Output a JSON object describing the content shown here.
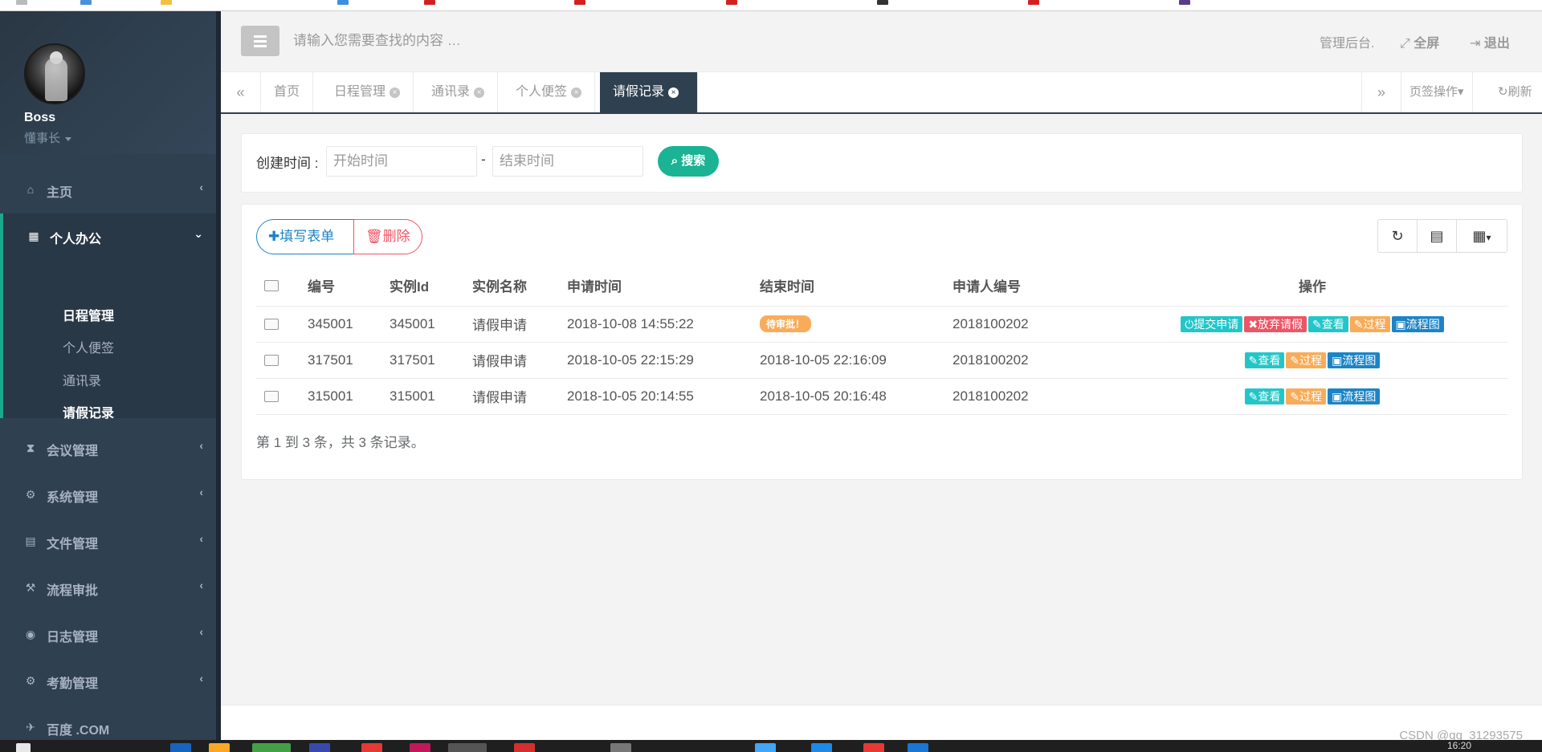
{
  "sidebar": {
    "user_name": "Boss",
    "user_role": "懂事长",
    "nav": [
      {
        "label": "主页",
        "icon": "home-icon"
      },
      {
        "label": "个人办公",
        "icon": "calendar-icon"
      },
      {
        "label": "会议管理",
        "icon": "hourglass-icon"
      },
      {
        "label": "系统管理",
        "icon": "gear-icon"
      },
      {
        "label": "文件管理",
        "icon": "file-icon"
      },
      {
        "label": "流程审批",
        "icon": "gavel-icon"
      },
      {
        "label": "日志管理",
        "icon": "eye-icon"
      },
      {
        "label": "考勤管理",
        "icon": "gears-icon"
      },
      {
        "label": "百度 .COM",
        "icon": "plane-icon"
      }
    ],
    "submenu": [
      "日程管理",
      "个人便签",
      "通讯录",
      "请假记录"
    ]
  },
  "topbar": {
    "search_placeholder": "请输入您需要查找的内容 …",
    "admin_label": "管理后台.",
    "fullscreen_label": "全屏",
    "logout_label": "退出"
  },
  "tabs": {
    "items": [
      "首页",
      "日程管理",
      "通讯录",
      "个人便签",
      "请假记录"
    ],
    "page_ops": "页签操作",
    "refresh": "刷新"
  },
  "filter": {
    "label": "创建时间 :",
    "start_placeholder": "开始时间",
    "separator": "-",
    "end_placeholder": "结束时间",
    "search_button": "搜索"
  },
  "toolbar": {
    "add_label": "填写表单",
    "delete_label": "删除"
  },
  "table": {
    "headers": [
      "编号",
      "实例Id",
      "实例名称",
      "申请时间",
      "结束时间",
      "申请人编号",
      "操作"
    ],
    "rows": [
      {
        "id": "345001",
        "instance": "345001",
        "name": "请假申请",
        "apply_time": "2018-10-08 14:55:22",
        "end_time": "",
        "status": "待审批！",
        "applicant": "2018100202",
        "actions": [
          "提交申请",
          "放弃请假",
          "查看",
          "过程",
          "流程图"
        ]
      },
      {
        "id": "317501",
        "instance": "317501",
        "name": "请假申请",
        "apply_time": "2018-10-05 22:15:29",
        "end_time": "2018-10-05 22:16:09",
        "applicant": "2018100202",
        "actions": [
          "查看",
          "过程",
          "流程图"
        ]
      },
      {
        "id": "315001",
        "instance": "315001",
        "name": "请假申请",
        "apply_time": "2018-10-05 20:14:55",
        "end_time": "2018-10-05 20:16:48",
        "applicant": "2018100202",
        "actions": [
          "查看",
          "过程",
          "流程图"
        ]
      }
    ],
    "pager_text": "第 1 到 3 条，共 3 条记录。"
  },
  "watermark": "CSDN @qq_31293575",
  "clock": "16:20",
  "colors": {
    "sidebar": "#2f4050",
    "accent": "#1ab394",
    "primary": "#1c84c6",
    "danger": "#ed5565",
    "warning": "#f8ac59",
    "info": "#23c6c8"
  }
}
